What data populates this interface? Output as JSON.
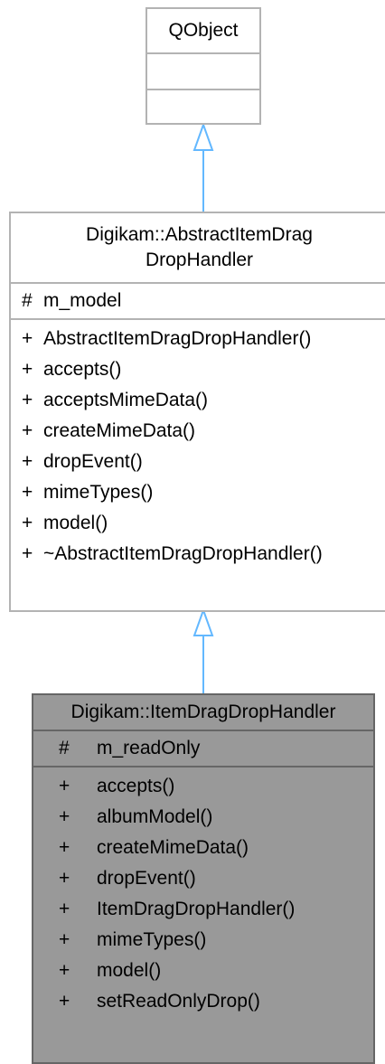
{
  "diagram": {
    "base_class": {
      "name": "QObject"
    },
    "middle_class": {
      "name_line1": "Digikam::AbstractItemDrag",
      "name_line2": "DropHandler",
      "attributes": [
        {
          "visibility": "#",
          "name": "m_model"
        }
      ],
      "methods": [
        {
          "visibility": "+",
          "name": "AbstractItemDragDropHandler()"
        },
        {
          "visibility": "+",
          "name": "accepts()"
        },
        {
          "visibility": "+",
          "name": "acceptsMimeData()"
        },
        {
          "visibility": "+",
          "name": "createMimeData()"
        },
        {
          "visibility": "+",
          "name": "dropEvent()"
        },
        {
          "visibility": "+",
          "name": "mimeTypes()"
        },
        {
          "visibility": "+",
          "name": "model()"
        },
        {
          "visibility": "+",
          "name": "~AbstractItemDragDropHandler()"
        }
      ]
    },
    "derived_class": {
      "name": "Digikam::ItemDragDropHandler",
      "attributes": [
        {
          "visibility": "#",
          "name": "m_readOnly"
        }
      ],
      "methods": [
        {
          "visibility": "+",
          "name": "accepts()"
        },
        {
          "visibility": "+",
          "name": "albumModel()"
        },
        {
          "visibility": "+",
          "name": "createMimeData()"
        },
        {
          "visibility": "+",
          "name": "dropEvent()"
        },
        {
          "visibility": "+",
          "name": "ItemDragDropHandler()"
        },
        {
          "visibility": "+",
          "name": "mimeTypes()"
        },
        {
          "visibility": "+",
          "name": "model()"
        },
        {
          "visibility": "+",
          "name": "setReadOnlyDrop()"
        }
      ]
    },
    "colors": {
      "edge": "#63b8ff",
      "border": "#b3b3b3",
      "highlight_fill": "#999999",
      "highlight_border": "#666666"
    }
  }
}
